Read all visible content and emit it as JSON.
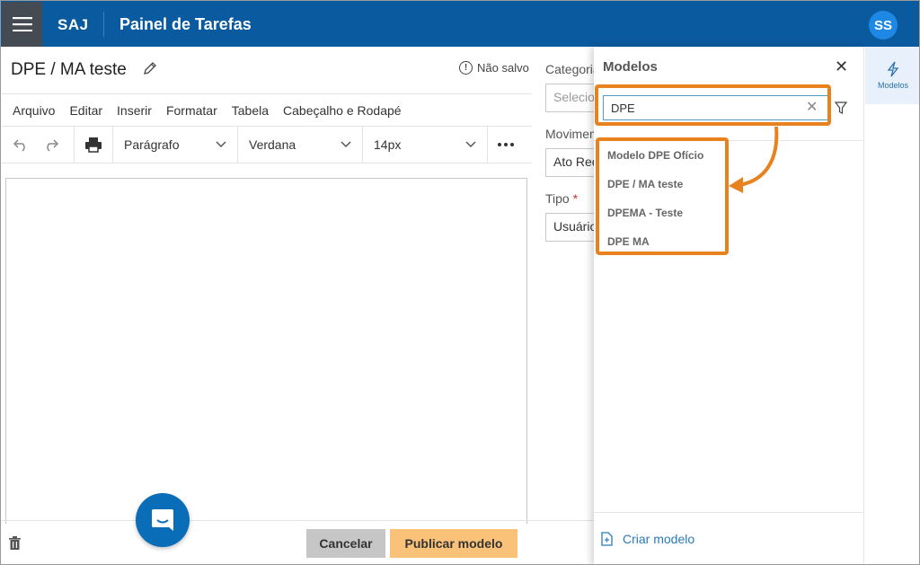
{
  "header": {
    "brand": "SAJ",
    "title": "Painel de Tarefas",
    "avatar": "SS"
  },
  "document": {
    "title": "DPE / MA teste",
    "status": "Não salvo"
  },
  "menubar": [
    "Arquivo",
    "Editar",
    "Inserir",
    "Formatar",
    "Tabela",
    "Cabeçalho e Rodapé"
  ],
  "toolbar": {
    "paragraph": "Parágrafo",
    "font": "Verdana",
    "size": "14px"
  },
  "form": {
    "category_label": "Categoria",
    "category_placeholder": "Selecione",
    "movement_label": "Movimentação",
    "movement_value": "Ato Recebido",
    "type_label": "Tipo",
    "type_value": "Usuário"
  },
  "footer": {
    "cancel": "Cancelar",
    "publish": "Publicar modelo"
  },
  "panel": {
    "title": "Modelos",
    "search_value": "DPE",
    "results": [
      "Modelo DPE Ofício",
      "DPE / MA teste",
      "DPEMA - Teste",
      "DPE MA"
    ],
    "create": "Criar modelo"
  },
  "rail": {
    "models": "Modelos"
  },
  "colors": {
    "header": "#0a5aa0",
    "accent": "#e8821e",
    "publish": "#fac178",
    "link": "#2a7ab8"
  }
}
